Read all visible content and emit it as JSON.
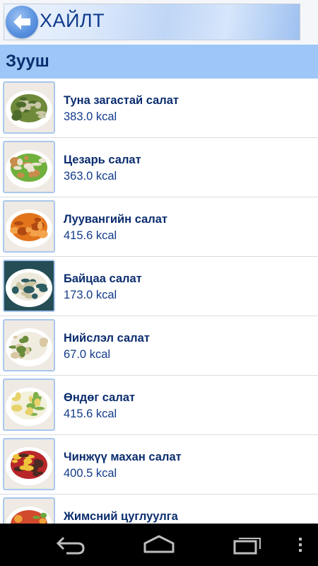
{
  "header": {
    "search_text": "ХАЙЛТ",
    "back_icon": "back-arrow-icon"
  },
  "category": {
    "title": "Зууш"
  },
  "items": [
    {
      "name": "Туна загастай салат",
      "kcal": "383.0 kcal",
      "colors": [
        "#6f8a3a",
        "#c9c7a5",
        "#4d6b2c"
      ]
    },
    {
      "name": "Цезарь салат",
      "kcal": "363.0 kcal",
      "colors": [
        "#6fb03c",
        "#c98c4c",
        "#e9e3d0"
      ]
    },
    {
      "name": "Луувангийн салат",
      "kcal": "415.6 kcal",
      "colors": [
        "#e2741c",
        "#f3a34a",
        "#b14a12"
      ]
    },
    {
      "name": "Байцаа салат",
      "kcal": "173.0 kcal",
      "colors": [
        "#eeeadb",
        "#c9c3a0",
        "#2d5c63"
      ]
    },
    {
      "name": "Нийслэл салат",
      "kcal": "67.0 kcal",
      "colors": [
        "#f1ece0",
        "#d9c8a3",
        "#6a8c3a"
      ]
    },
    {
      "name": "Өндөг салат",
      "kcal": "415.6 kcal",
      "colors": [
        "#f3f0dc",
        "#7eb04a",
        "#e8d26a"
      ]
    },
    {
      "name": "Чинжүү махан салат",
      "kcal": "400.5 kcal",
      "colors": [
        "#b8262a",
        "#f0c23a",
        "#4a2a22"
      ]
    },
    {
      "name": "Жимсний цуглуулга",
      "kcal": "",
      "colors": [
        "#d14a2c",
        "#f0a23a",
        "#6aa83a"
      ]
    }
  ],
  "navbar": {
    "icons": [
      "back-nav-icon",
      "home-nav-icon",
      "recents-nav-icon",
      "menu-dots-icon"
    ]
  }
}
